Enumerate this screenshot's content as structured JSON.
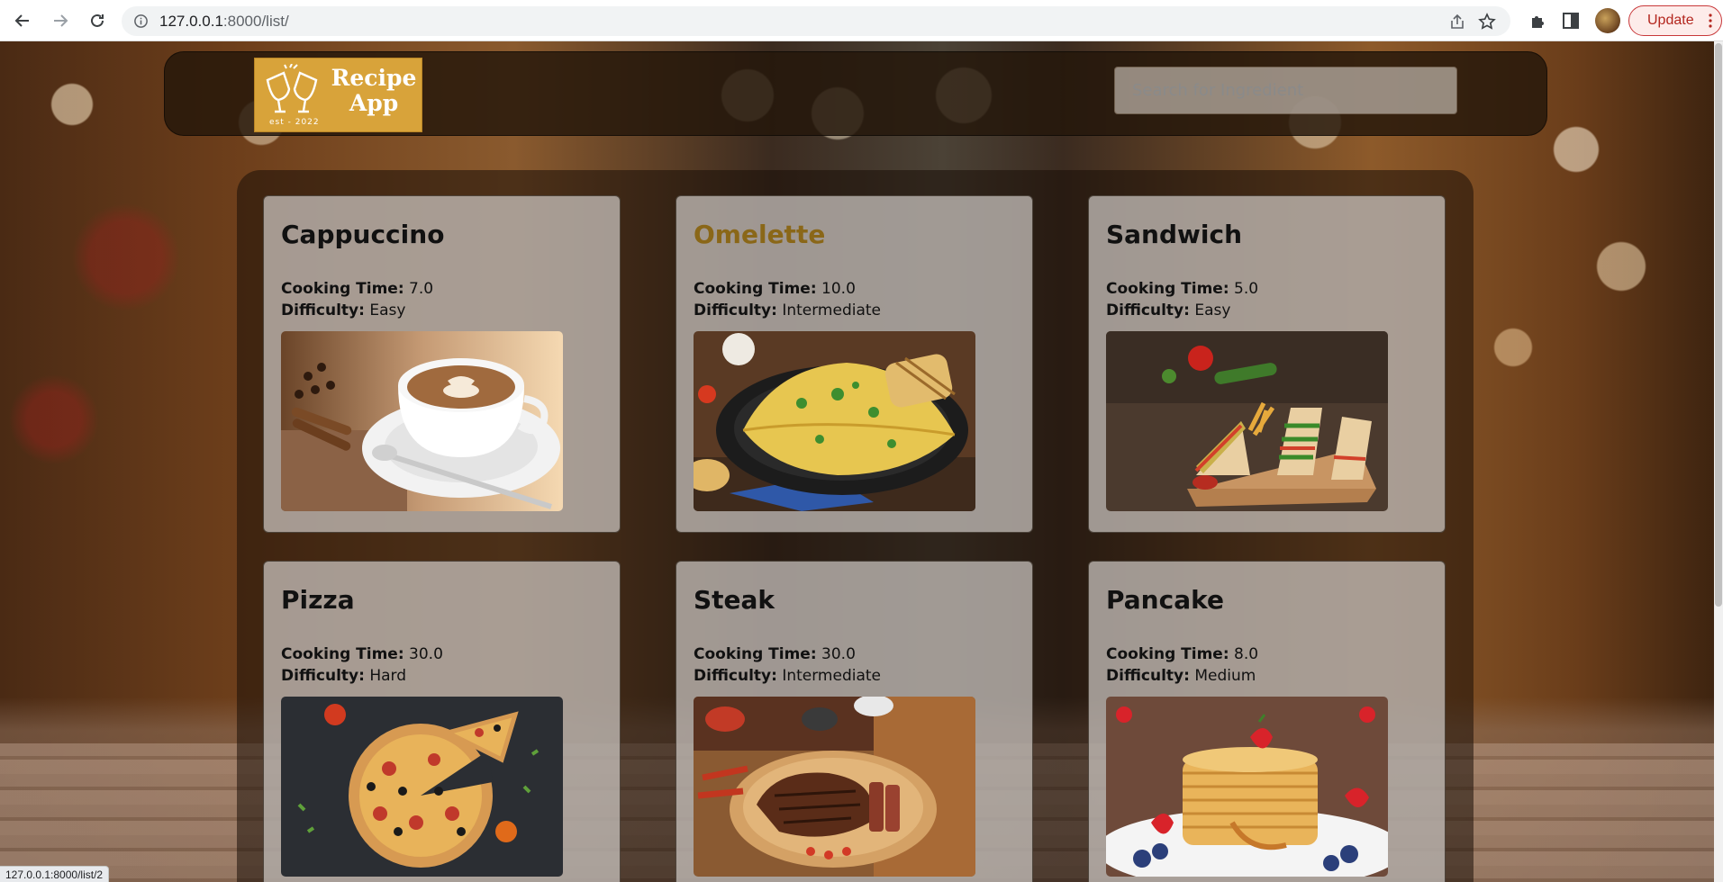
{
  "browser": {
    "url_host": "127.0.0.1",
    "url_rest": ":8000/list/",
    "update_label": "Update",
    "status_url": "127.0.0.1:8000/list/2"
  },
  "header": {
    "logo_title_line1": "Recipe",
    "logo_title_line2": "App",
    "logo_est": "est  -  2022",
    "search_placeholder": "Search for Ingredient"
  },
  "labels": {
    "cooking_time": "Cooking Time:",
    "difficulty": "Difficulty:"
  },
  "recipes": [
    {
      "name": "Cappuccino",
      "cooking_time": "7.0",
      "difficulty": "Easy",
      "image": "cappuccino-photo"
    },
    {
      "name": "Omelette",
      "cooking_time": "10.0",
      "difficulty": "Intermediate",
      "image": "omelette-photo",
      "hovered": true
    },
    {
      "name": "Sandwich",
      "cooking_time": "5.0",
      "difficulty": "Easy",
      "image": "sandwich-photo"
    },
    {
      "name": "Pizza",
      "cooking_time": "30.0",
      "difficulty": "Hard",
      "image": "pizza-photo"
    },
    {
      "name": "Steak",
      "cooking_time": "30.0",
      "difficulty": "Intermediate",
      "image": "steak-photo"
    },
    {
      "name": "Pancake",
      "cooking_time": "8.0",
      "difficulty": "Medium",
      "image": "pancake-photo"
    }
  ],
  "colors": {
    "accent_gold": "#d8a33a",
    "hover_link": "#8a6718",
    "update_red": "#b3261e"
  }
}
